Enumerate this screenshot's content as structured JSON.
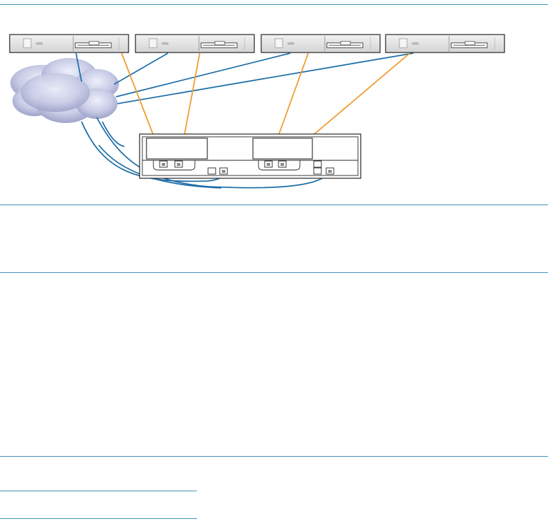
{
  "diagram": {
    "servers": [
      {
        "name": "server-1"
      },
      {
        "name": "server-2"
      },
      {
        "name": "server-3"
      },
      {
        "name": "server-4"
      }
    ],
    "cloud": {
      "icon": "network-cloud-icon"
    },
    "storage": {
      "name": "storage-enclosure"
    },
    "colors": {
      "server_link": "#f29a2e",
      "network_link": "#1f6ea8",
      "rule": "#3f8fb7",
      "device_fill": "#e3e3e3",
      "device_stroke": "#222222"
    }
  }
}
